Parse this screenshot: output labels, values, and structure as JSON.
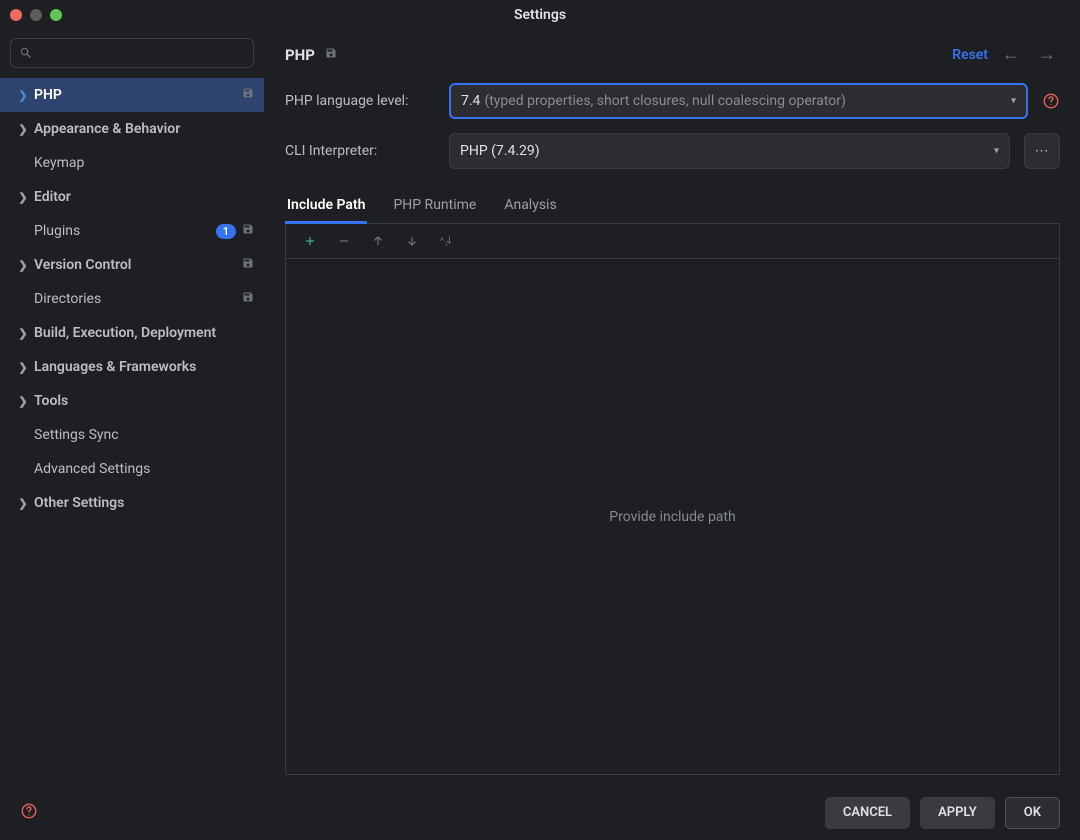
{
  "window": {
    "title": "Settings"
  },
  "sidebar": {
    "search_placeholder": "",
    "items": [
      {
        "label": "PHP",
        "expandable": true,
        "selected": true,
        "save_marker": true
      },
      {
        "label": "Appearance & Behavior",
        "expandable": true
      },
      {
        "label": "Keymap",
        "leaf": true,
        "indent": true
      },
      {
        "label": "Editor",
        "expandable": true
      },
      {
        "label": "Plugins",
        "leaf": true,
        "indent": true,
        "badge": "1",
        "save_marker": true
      },
      {
        "label": "Version Control",
        "expandable": true,
        "save_marker": true
      },
      {
        "label": "Directories",
        "leaf": true,
        "indent": true,
        "save_marker": true
      },
      {
        "label": "Build, Execution, Deployment",
        "expandable": true
      },
      {
        "label": "Languages & Frameworks",
        "expandable": true
      },
      {
        "label": "Tools",
        "expandable": true
      },
      {
        "label": "Settings Sync",
        "leaf": true,
        "indent": true
      },
      {
        "label": "Advanced Settings",
        "leaf": true,
        "indent": true
      },
      {
        "label": "Other Settings",
        "expandable": true
      }
    ]
  },
  "header": {
    "title": "PHP",
    "reset_label": "Reset"
  },
  "form": {
    "language_level_label": "PHP language level:",
    "language_level_value": "7.4",
    "language_level_desc": "(typed properties, short closures, null coalescing operator)",
    "cli_label": "CLI Interpreter:",
    "cli_value": "PHP (7.4.29)"
  },
  "tabs": [
    {
      "label": "Include Path",
      "active": true
    },
    {
      "label": "PHP Runtime"
    },
    {
      "label": "Analysis"
    }
  ],
  "list": {
    "empty_text": "Provide include path"
  },
  "footer": {
    "cancel": "CANCEL",
    "apply": "APPLY",
    "ok": "OK"
  }
}
